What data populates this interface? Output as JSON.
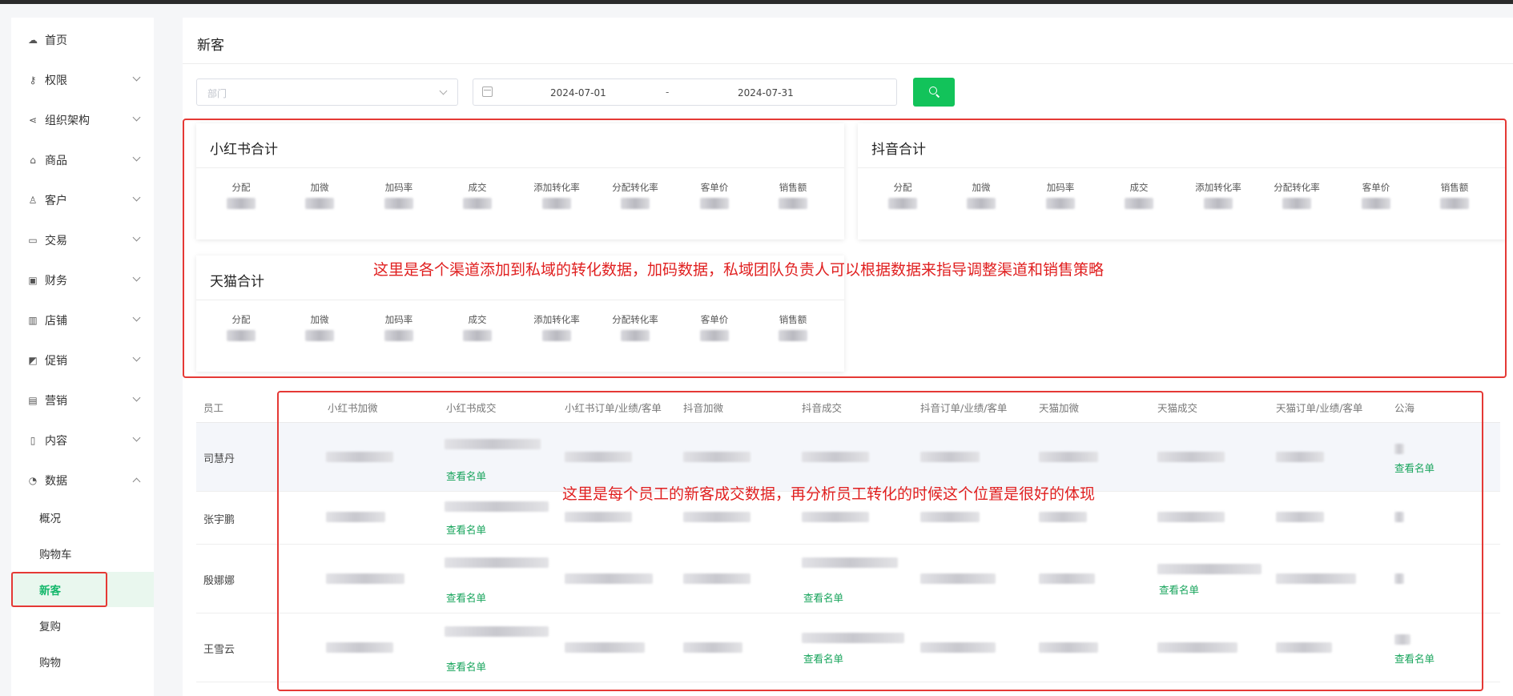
{
  "sidebar": {
    "items": [
      {
        "label": "首页",
        "icon": "cloud-icon"
      },
      {
        "label": "权限",
        "icon": "key-icon"
      },
      {
        "label": "组织架构",
        "icon": "share-icon"
      },
      {
        "label": "商品",
        "icon": "shop-bag-icon"
      },
      {
        "label": "客户",
        "icon": "user-icon"
      },
      {
        "label": "交易",
        "icon": "folder-icon"
      },
      {
        "label": "财务",
        "icon": "wallet-icon"
      },
      {
        "label": "店铺",
        "icon": "building-icon"
      },
      {
        "label": "促销",
        "icon": "tag-icon"
      },
      {
        "label": "营销",
        "icon": "gift-icon"
      },
      {
        "label": "内容",
        "icon": "document-icon"
      },
      {
        "label": "数据",
        "icon": "pie-chart-icon"
      }
    ],
    "sub_items": [
      "概况",
      "购物车",
      "新客",
      "复购",
      "购物"
    ],
    "active_sub": "新客"
  },
  "page": {
    "title": "新客"
  },
  "filters": {
    "dept_placeholder": "部门",
    "date_start": "2024-07-01",
    "date_sep": "-",
    "date_end": "2024-07-31"
  },
  "cards": [
    {
      "title": "小红书合计",
      "metrics": [
        "分配",
        "加微",
        "加码率",
        "成交",
        "添加转化率",
        "分配转化率",
        "客单价",
        "销售额"
      ]
    },
    {
      "title": "抖音合计",
      "metrics": [
        "分配",
        "加微",
        "加码率",
        "成交",
        "添加转化率",
        "分配转化率",
        "客单价",
        "销售额"
      ]
    },
    {
      "title": "天猫合计",
      "metrics": [
        "分配",
        "加微",
        "加码率",
        "成交",
        "添加转化率",
        "分配转化率",
        "客单价",
        "销售额"
      ]
    }
  ],
  "annotations": {
    "cards_note": "这里是各个渠道添加到私域的转化数据，加码数据，私域团队负责人可以根据数据来指导调整渠道和销售策略",
    "table_note": "这里是每个员工的新客成交数据，再分析员工转化的时候这个位置是很好的体现"
  },
  "table": {
    "columns": [
      "员工",
      "小红书加微",
      "小红书成交",
      "小红书订单/业绩/客单",
      "抖音加微",
      "抖音成交",
      "抖音订单/业绩/客单",
      "天猫加微",
      "天猫成交",
      "天猫订单/业绩/客单",
      "公海"
    ],
    "rows": [
      {
        "name": "司慧丹"
      },
      {
        "name": "张宇鹏"
      },
      {
        "name": "殷娜娜"
      },
      {
        "name": "王雪云"
      }
    ],
    "link_label": "查看名单"
  },
  "colors": {
    "accent": "#12c35a",
    "active_bg": "#e9f7ee",
    "annotation": "#e02020"
  }
}
